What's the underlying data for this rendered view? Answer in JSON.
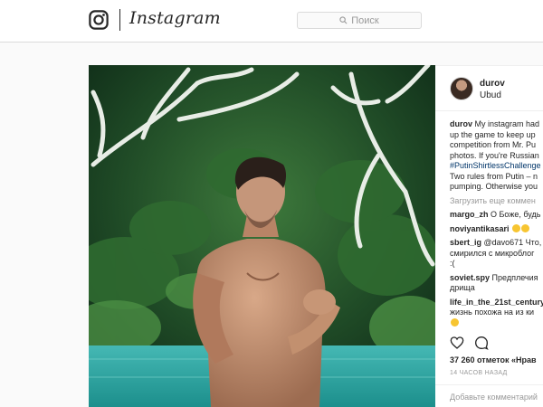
{
  "header": {
    "brand": "Instagram",
    "search_placeholder": "Поиск"
  },
  "post": {
    "username": "durov",
    "location": "Ubud",
    "caption_user": "durov",
    "caption_lines": [
      " My instagram had",
      "up the game to keep up",
      "competition from Mr. Pu",
      "photos. If you're Russian"
    ],
    "hashtag": "#PutinShirtlessChallenge",
    "caption_tail": [
      "Two rules from Putin – n",
      "pumping. Otherwise you"
    ],
    "load_more": "Загрузить еще коммен",
    "comments": [
      {
        "user": "margo_zh",
        "text": " О Боже, будь",
        "emoji": false
      },
      {
        "user": "noviyantikasari",
        "text": " ",
        "emoji": true
      },
      {
        "user": "sbert_ig",
        "text": " @davo671 Что,",
        "extra": "смирился с микроблог",
        "tail": ":("
      },
      {
        "user": "soviet.spy",
        "text": " Предплечия",
        "extra": "дрища"
      },
      {
        "user": "life_in_the_21st_century",
        "text": "",
        "extra": "жизнь похожа на из ки",
        "emoji_line": true
      }
    ],
    "likes": "37 260 отметок «Нрав",
    "time": "14 ЧАСОВ НАЗАД",
    "add_comment": "Добавьте комментарий"
  }
}
